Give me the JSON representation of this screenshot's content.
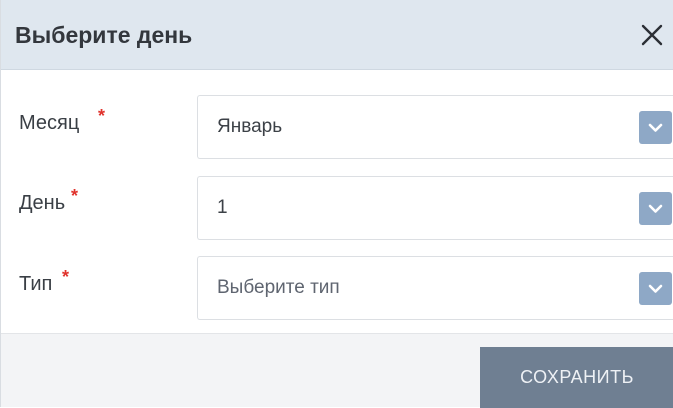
{
  "dialog": {
    "title": "Выберите день",
    "close_icon": "close-icon"
  },
  "fields": [
    {
      "label": "Месяц",
      "required_mark": "*",
      "value": "Январь",
      "is_placeholder": false,
      "icon": "chevron-down-icon"
    },
    {
      "label": "День",
      "required_mark": "*",
      "value": "1",
      "is_placeholder": false,
      "icon": "chevron-down-icon"
    },
    {
      "label": "Тип",
      "required_mark": "*",
      "value": "Выберите тип",
      "is_placeholder": true,
      "icon": "chevron-down-icon"
    }
  ],
  "footer": {
    "save_label": "СОХРАНИТЬ"
  },
  "colors": {
    "header_bg": "#dfe7ef",
    "dropdown_button": "#8ea8c6",
    "required_mark": "#e0322c",
    "save_button": "#6f7f92"
  }
}
